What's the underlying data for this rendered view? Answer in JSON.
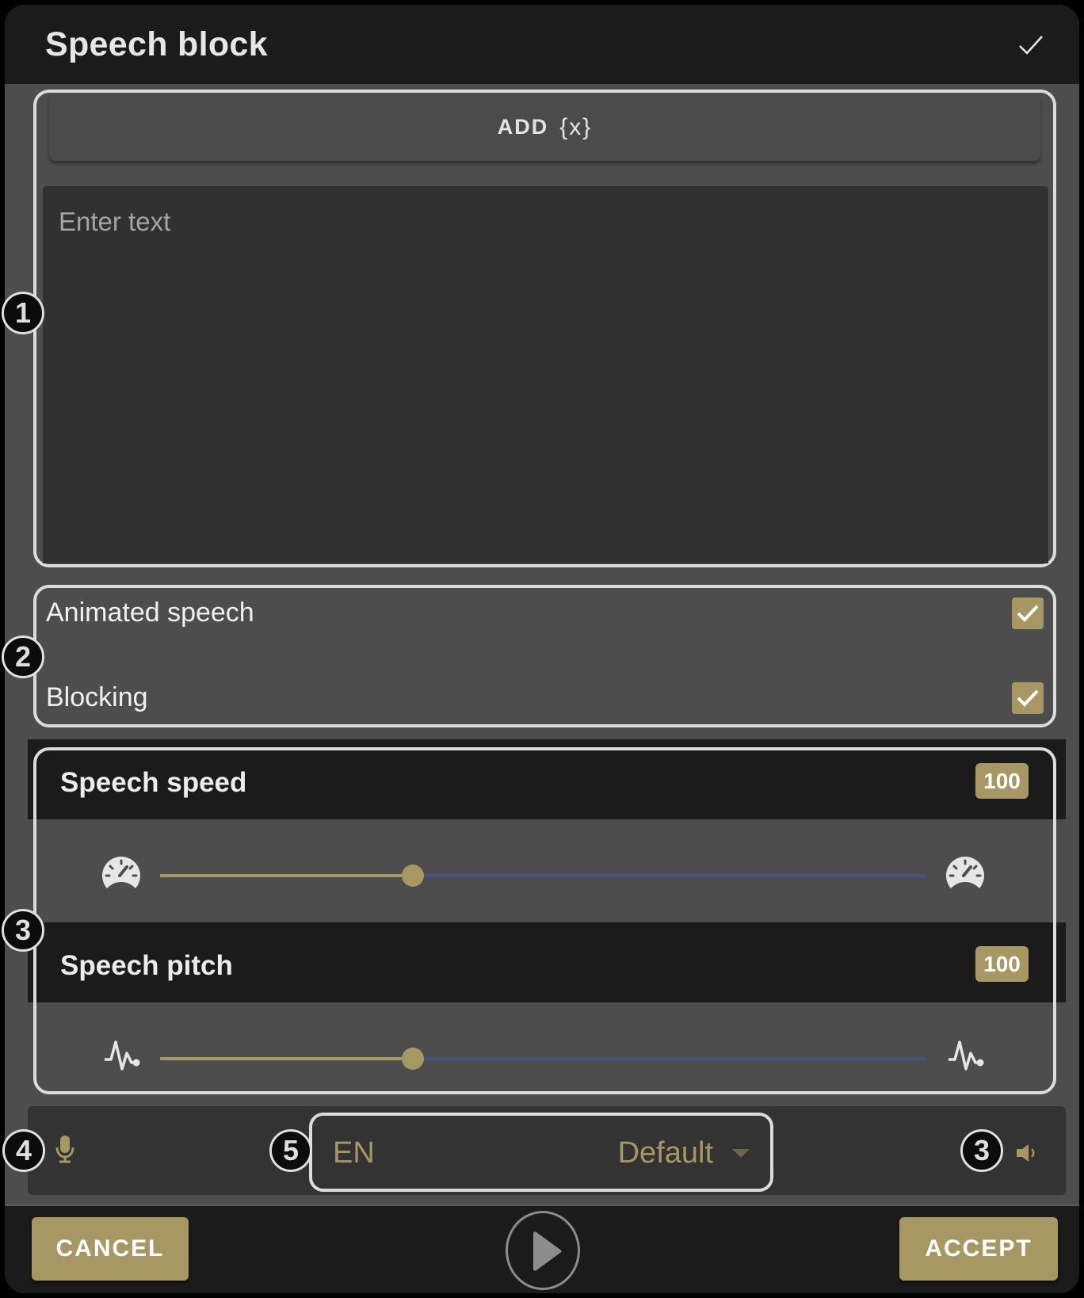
{
  "dialog": {
    "title": "Speech block",
    "header_icon": "check-icon"
  },
  "text_group": {
    "add_button": {
      "label": "ADD",
      "variable_symbol": "{x}"
    },
    "text_input": {
      "value": "",
      "placeholder": "Enter text"
    }
  },
  "options": [
    {
      "label": "Animated speech",
      "checked": true
    },
    {
      "label": "Blocking",
      "checked": true
    }
  ],
  "speech_speed": {
    "label": "Speech speed",
    "value": "100",
    "slider_fraction": 0.33,
    "min_icon": "speedometer-slow-icon",
    "max_icon": "speedometer-fast-icon"
  },
  "speech_pitch": {
    "label": "Speech pitch",
    "value": "100",
    "slider_fraction": 0.33,
    "min_icon": "pulse-icon",
    "max_icon": "pulse-icon"
  },
  "voice_bar": {
    "mic_icon": "microphone-icon",
    "language": "EN",
    "voice": "Default",
    "volume_icon": "volume-icon"
  },
  "footer": {
    "cancel_label": "CANCEL",
    "accept_label": "ACCEPT",
    "play_icon": "play-icon"
  },
  "callouts": [
    "1",
    "2",
    "3",
    "4",
    "5",
    "3"
  ],
  "colors": {
    "accent_gold": "#a79763",
    "slider_track": "#445480",
    "header_bg": "#1b1b1b",
    "panel_bg": "#4d4d4d"
  }
}
